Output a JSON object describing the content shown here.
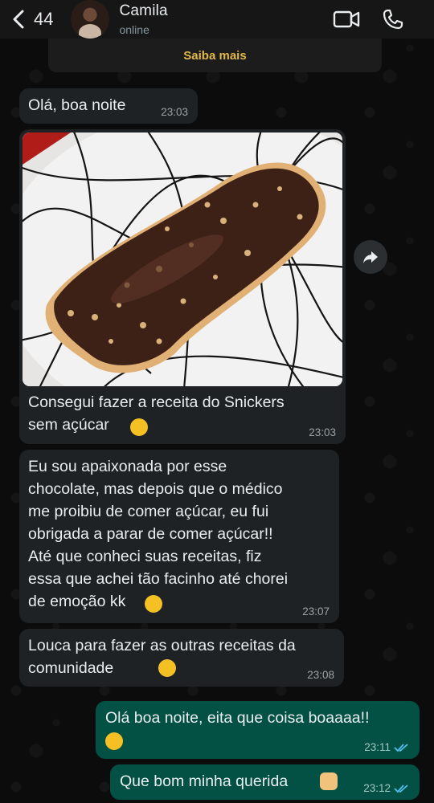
{
  "header": {
    "back_count": "44",
    "contact_name": "Camila",
    "contact_status": "online"
  },
  "banner": {
    "text": "Saiba mais"
  },
  "messages": [
    {
      "text": "Olá, boa noite",
      "time": "23:03",
      "dir": "in"
    },
    {
      "text": "Consegui fazer a receita do Snickers\nsem açúcar",
      "emoji": "star-struck-emoji",
      "time": "23:03",
      "dir": "in",
      "image": "chocolate-peanut-bar-photo"
    },
    {
      "text": "Eu sou apaixonada por esse\nchocolate, mas depois que o médico\nme proibiu de comer açúcar, eu fui\nobrigada a parar de comer açúcar!!\nAté que conheci suas receitas, fiz\nessa que achei tão facinho até chorei\nde emoção kk",
      "emoji": "smiling-face-with-hearts-emoji",
      "time": "23:07",
      "dir": "in"
    },
    {
      "text": "Louca para fazer as outras receitas da\ncomunidade",
      "emoji": "face-with-hand-over-mouth-emoji",
      "time": "23:08",
      "dir": "in"
    },
    {
      "text": "Olá boa noite, eita que coisa boaaaa!!",
      "emoji": "relieved-face-emoji",
      "time": "23:11",
      "dir": "out",
      "status": "read"
    },
    {
      "text": "Que bom minha querida",
      "emoji": "raising-hands-emoji",
      "time": "23:12",
      "dir": "out",
      "status": "read"
    }
  ],
  "colors": {
    "incoming_bubble": "#1f2224",
    "outgoing_bubble": "#025144",
    "read_ticks": "#53bdeb",
    "banner_link": "#e2b84a"
  }
}
